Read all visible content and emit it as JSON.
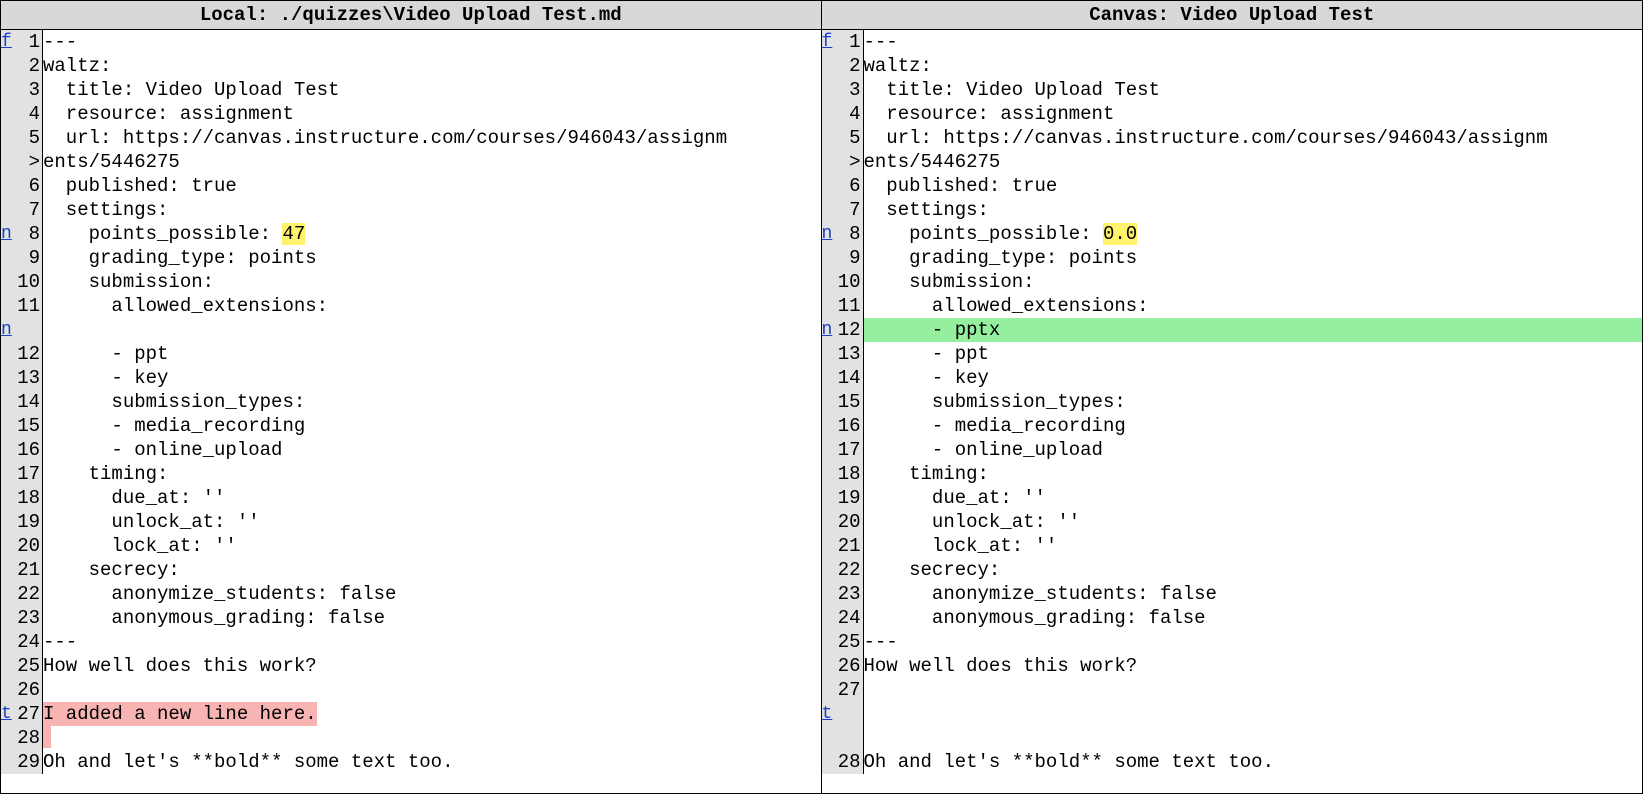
{
  "left": {
    "title": "Local: ./quizzes\\Video Upload Test.md",
    "rows": [
      {
        "mark": "f",
        "n": "1",
        "t": "---"
      },
      {
        "mark": "",
        "n": "2",
        "t": "waltz:"
      },
      {
        "mark": "",
        "n": "3",
        "t": "  title: Video Upload Test"
      },
      {
        "mark": "",
        "n": "4",
        "t": "  resource: assignment"
      },
      {
        "mark": "",
        "n": "5",
        "t": "  url: https://canvas.instructure.com/courses/946043/assignm"
      },
      {
        "mark": "",
        "n": ">",
        "t": "ents/5446275"
      },
      {
        "mark": "",
        "n": "6",
        "t": "  published: true"
      },
      {
        "mark": "",
        "n": "7",
        "t": "  settings:"
      },
      {
        "mark": "n",
        "n": "8",
        "t": "    points_possible: ",
        "hlY": "47"
      },
      {
        "mark": "",
        "n": "9",
        "t": "    grading_type: points"
      },
      {
        "mark": "",
        "n": "10",
        "t": "    submission:"
      },
      {
        "mark": "",
        "n": "11",
        "t": "      allowed_extensions:"
      },
      {
        "mark": "n",
        "n": "",
        "t": ""
      },
      {
        "mark": "",
        "n": "12",
        "t": "      - ppt"
      },
      {
        "mark": "",
        "n": "13",
        "t": "      - key"
      },
      {
        "mark": "",
        "n": "14",
        "t": "      submission_types:"
      },
      {
        "mark": "",
        "n": "15",
        "t": "      - media_recording"
      },
      {
        "mark": "",
        "n": "16",
        "t": "      - online_upload"
      },
      {
        "mark": "",
        "n": "17",
        "t": "    timing:"
      },
      {
        "mark": "",
        "n": "18",
        "t": "      due_at: ''"
      },
      {
        "mark": "",
        "n": "19",
        "t": "      unlock_at: ''"
      },
      {
        "mark": "",
        "n": "20",
        "t": "      lock_at: ''"
      },
      {
        "mark": "",
        "n": "21",
        "t": "    secrecy:"
      },
      {
        "mark": "",
        "n": "22",
        "t": "      anonymize_students: false"
      },
      {
        "mark": "",
        "n": "23",
        "t": "      anonymous_grading: false"
      },
      {
        "mark": "",
        "n": "24",
        "t": "---"
      },
      {
        "mark": "",
        "n": "25",
        "t": "How well does this work?"
      },
      {
        "mark": "",
        "n": "26",
        "t": ""
      },
      {
        "mark": "t",
        "n": "27",
        "t": "",
        "hlDel": "I added a new line here."
      },
      {
        "mark": "",
        "n": "28",
        "t": "",
        "delStub": true
      },
      {
        "mark": "",
        "n": "29",
        "t": "Oh and let's **bold** some text too."
      }
    ]
  },
  "right": {
    "title": "Canvas: Video Upload Test",
    "rows": [
      {
        "mark": "f",
        "n": "1",
        "t": "---"
      },
      {
        "mark": "",
        "n": "2",
        "t": "waltz:"
      },
      {
        "mark": "",
        "n": "3",
        "t": "  title: Video Upload Test"
      },
      {
        "mark": "",
        "n": "4",
        "t": "  resource: assignment"
      },
      {
        "mark": "",
        "n": "5",
        "t": "  url: https://canvas.instructure.com/courses/946043/assignm"
      },
      {
        "mark": "",
        "n": ">",
        "t": "ents/5446275"
      },
      {
        "mark": "",
        "n": "6",
        "t": "  published: true"
      },
      {
        "mark": "",
        "n": "7",
        "t": "  settings:"
      },
      {
        "mark": "n",
        "n": "8",
        "t": "    points_possible: ",
        "hlY": "0.0"
      },
      {
        "mark": "",
        "n": "9",
        "t": "    grading_type: points"
      },
      {
        "mark": "",
        "n": "10",
        "t": "    submission:"
      },
      {
        "mark": "",
        "n": "11",
        "t": "      allowed_extensions:"
      },
      {
        "mark": "n",
        "n": "12",
        "t": "",
        "hlAdd": "      - pptx"
      },
      {
        "mark": "",
        "n": "13",
        "t": "      - ppt"
      },
      {
        "mark": "",
        "n": "14",
        "t": "      - key"
      },
      {
        "mark": "",
        "n": "15",
        "t": "      submission_types:"
      },
      {
        "mark": "",
        "n": "16",
        "t": "      - media_recording"
      },
      {
        "mark": "",
        "n": "17",
        "t": "      - online_upload"
      },
      {
        "mark": "",
        "n": "18",
        "t": "    timing:"
      },
      {
        "mark": "",
        "n": "19",
        "t": "      due_at: ''"
      },
      {
        "mark": "",
        "n": "20",
        "t": "      unlock_at: ''"
      },
      {
        "mark": "",
        "n": "21",
        "t": "      lock_at: ''"
      },
      {
        "mark": "",
        "n": "22",
        "t": "    secrecy:"
      },
      {
        "mark": "",
        "n": "23",
        "t": "      anonymize_students: false"
      },
      {
        "mark": "",
        "n": "24",
        "t": "      anonymous_grading: false"
      },
      {
        "mark": "",
        "n": "25",
        "t": "---"
      },
      {
        "mark": "",
        "n": "26",
        "t": "How well does this work?"
      },
      {
        "mark": "",
        "n": "27",
        "t": ""
      },
      {
        "mark": "t",
        "n": "",
        "t": ""
      },
      {
        "mark": "",
        "n": "",
        "t": ""
      },
      {
        "mark": "",
        "n": "28",
        "t": "Oh and let's **bold** some text too."
      }
    ]
  }
}
